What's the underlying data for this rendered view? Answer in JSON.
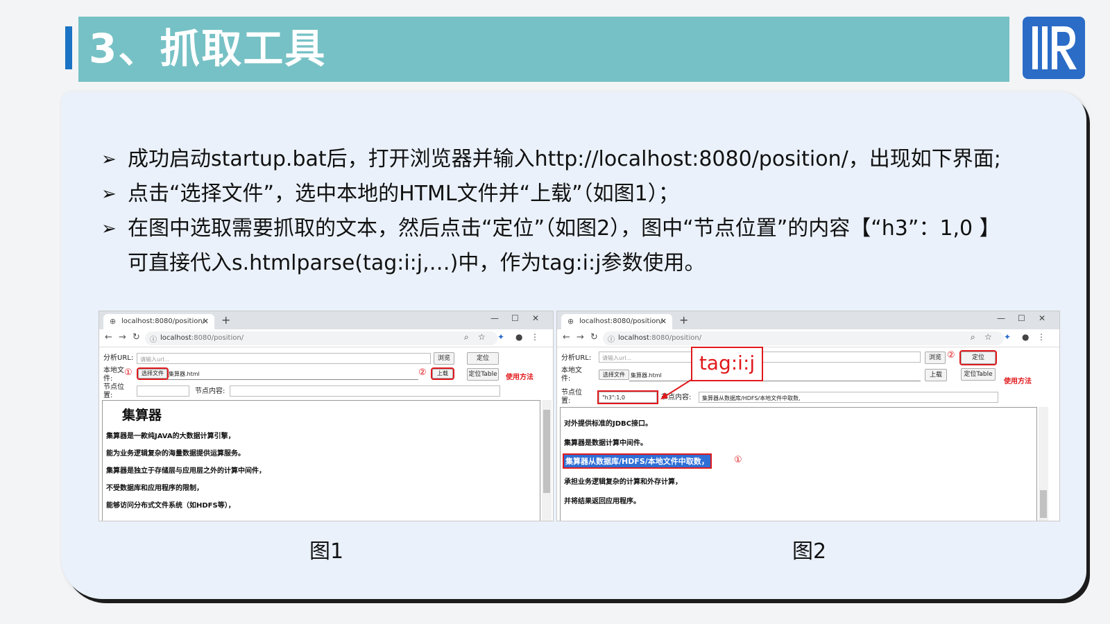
{
  "header": {
    "title": "3、抓取工具"
  },
  "bullets": [
    {
      "text": "成功启动startup.bat后，打开浏览器并输入http://localhost:8080/position/，出现如下界面;"
    },
    {
      "text": "点击“选择文件”，选中本地的HTML文件并“上载”（如图1）；"
    },
    {
      "text": "在图中选取需要抓取的文本，然后点击“定位”（如图2），图中“节点位置”的内容【“h3”：1,0 】",
      "cont": "可直接代入s.htmlparse(tag:i:j,…)中，作为tag:i:j参数使用。"
    }
  ],
  "browser": {
    "tab_title": "localhost:8080/position/",
    "url_host": "localhost",
    "url_path": ":8080/position/",
    "min": "—",
    "max": "☐",
    "close": "✕",
    "plus": "+"
  },
  "form": {
    "url_label": "分析URL:",
    "url_placeholder": "请输入url...",
    "browse": "浏览",
    "locate": "定位",
    "file_label": "本地文件:",
    "choose_file": "选择文件",
    "file_name": "集算器.html",
    "upload": "上载",
    "locate_table": "定位Table",
    "usage": "使用方法",
    "node_pos_label": "节点位置:",
    "node_content_label": "节点内容:"
  },
  "fig1": {
    "heading": "集算器",
    "lines": [
      "集算器是一款纯JAVA的大数据计算引擎，",
      "能为业务逻辑复杂的海量数据提供运算服务。",
      "集算器是独立于存储层与应用层之外的计算中间件，",
      "不受数据库和应用程序的限制，",
      "能够访问分布式文件系统（如HDFS等），"
    ],
    "mark1": "①",
    "mark2": "②",
    "caption": "图1"
  },
  "fig2": {
    "node_pos_value": "\"h3\":1,0",
    "node_content_value": "集算器从数据库/HDFS/本地文件中取数,",
    "lines": [
      "对外提供标准的JDBC接口。",
      "集算器是数据计算中间件。",
      "集算器从数据库/HDFS/本地文件中取数，",
      "承担业务逻辑复杂的计算和外存计算，",
      "并将结果返回应用程序。"
    ],
    "mark1": "①",
    "mark2": "②",
    "tag_label": "tag:i:j",
    "caption": "图2"
  },
  "colors": {
    "accent": "#1a73c4",
    "title_bar": "#76c1c5",
    "red": "#e0191c",
    "highlight": "#2f6fd6"
  },
  "icons": [
    "globe-icon",
    "back-arrow-icon",
    "forward-arrow-icon",
    "reload-icon",
    "info-icon",
    "zoom-icon",
    "star-icon",
    "extension-icon",
    "account-icon",
    "menu-icon",
    "logo"
  ]
}
